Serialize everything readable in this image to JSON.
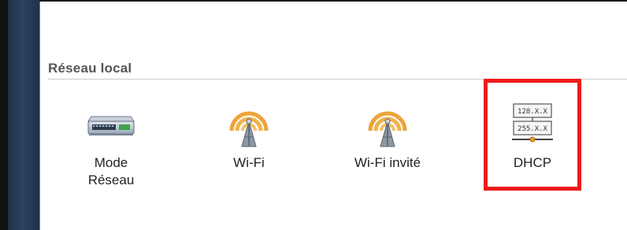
{
  "section": {
    "title": "Réseau local"
  },
  "tiles": [
    {
      "label_line1": "Mode",
      "label_line2": "Réseau",
      "icon": "network-switch-icon"
    },
    {
      "label": "Wi-Fi",
      "icon": "wifi-antenna-icon"
    },
    {
      "label": "Wi-Fi invité",
      "icon": "guest-wifi-antenna-icon"
    },
    {
      "label": "DHCP",
      "icon": "dhcp-address-icon",
      "addr1": "128.X.X",
      "addr2": "255.X.X"
    }
  ],
  "colors": {
    "highlight": "#ee1c1c",
    "antenna_orange": "#f0a030",
    "sidebar": "#2a4360"
  }
}
